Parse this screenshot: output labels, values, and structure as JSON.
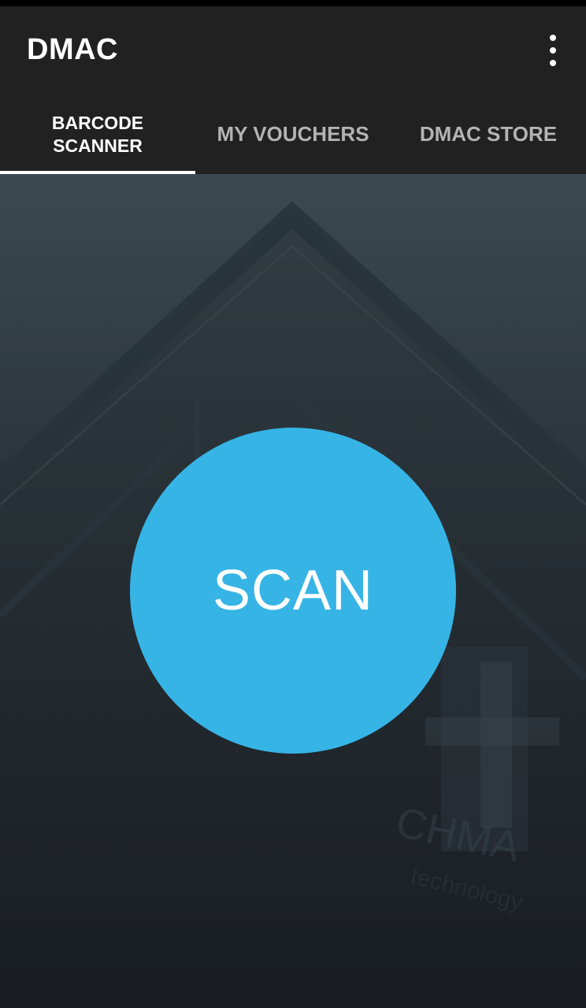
{
  "app": {
    "title": "DMAC"
  },
  "tabs": [
    {
      "label": "BARCODE\nSCANNER",
      "active": true
    },
    {
      "label": "MY VOUCHERS",
      "active": false
    },
    {
      "label": "DMAC STORE",
      "active": false
    }
  ],
  "main": {
    "scan_label": "SCAN"
  },
  "icons": {
    "overflow": "more-vertical-icon"
  },
  "colors": {
    "app_bar": "#212121",
    "accent": "#36b4e6",
    "tab_active": "#ffffff",
    "tab_inactive": "#b3b3b3"
  }
}
